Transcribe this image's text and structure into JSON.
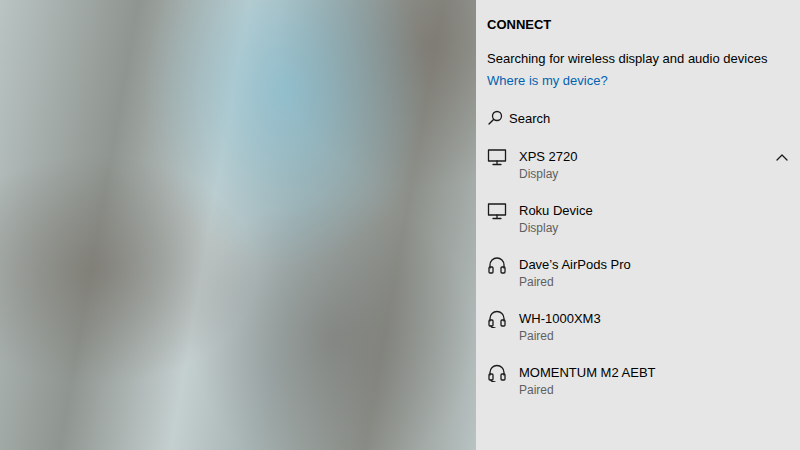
{
  "panel": {
    "title": "CONNECT",
    "status": "Searching for wireless display and audio devices",
    "help_link": "Where is my device?",
    "search": {
      "label": "Search"
    },
    "devices": [
      {
        "name": "XPS 2720",
        "status": "Display",
        "kind": "display",
        "expanded": true
      },
      {
        "name": "Roku Device",
        "status": "Display",
        "kind": "display",
        "expanded": false
      },
      {
        "name": "Dave’s AirPods Pro",
        "status": "Paired",
        "kind": "headphones",
        "expanded": false
      },
      {
        "name": "WH-1000XM3",
        "status": "Paired",
        "kind": "headset",
        "expanded": false
      },
      {
        "name": "MOMENTUM M2 AEBT",
        "status": "Paired",
        "kind": "headset",
        "expanded": false
      }
    ]
  }
}
